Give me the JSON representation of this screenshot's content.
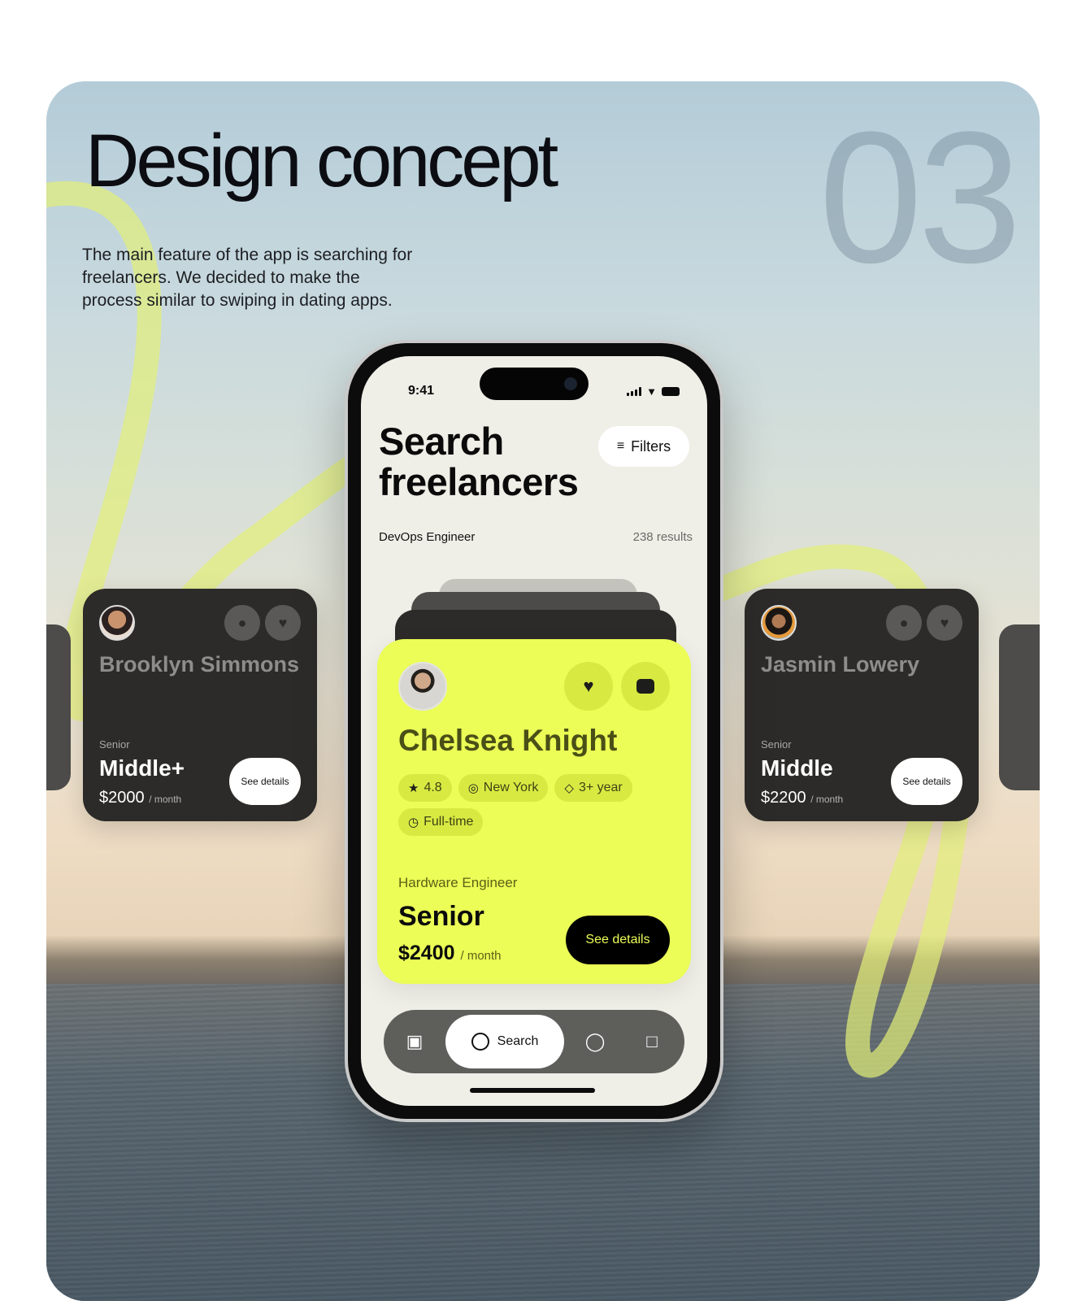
{
  "header": {
    "title": "Design concept",
    "description": "The main feature of the app is searching for freelancers. We decided to make the process similar to swiping in dating apps.",
    "section_number": "03"
  },
  "colors": {
    "accent": "#ebfd56",
    "card_dark": "#2c2b29",
    "tabbar": "#5e5e5b",
    "screen_bg": "#efeee7"
  },
  "phone": {
    "status_bar": {
      "time": "9:41"
    },
    "page_title_line1": "Search",
    "page_title_line2": "freelancers",
    "filters_label": "Filters",
    "query": "DevOps Engineer",
    "results": "238 results",
    "main_card": {
      "name": "Chelsea Knight",
      "rating": "4.8",
      "location": "New York",
      "experience": "3+ year",
      "employment": "Full-time",
      "role": "Hardware Engineer",
      "level": "Senior",
      "price": "$2400",
      "period": "/ month",
      "details_label": "See details"
    },
    "tabbar": {
      "items": [
        {
          "icon": "briefcase-icon",
          "label": ""
        },
        {
          "icon": "search-icon",
          "label": "Search",
          "active": true
        },
        {
          "icon": "profile-icon",
          "label": ""
        },
        {
          "icon": "chat-icon",
          "label": ""
        }
      ]
    }
  },
  "side_cards": [
    {
      "name": "Brooklyn Simmons",
      "level_label": "Senior",
      "level": "Middle+",
      "price": "$2000",
      "period": "/ month",
      "details_label": "See details"
    },
    {
      "name": "Jasmin Lowery",
      "level_label": "Senior",
      "level": "Middle",
      "price": "$2200",
      "period": "/ month",
      "details_label": "See details"
    }
  ]
}
